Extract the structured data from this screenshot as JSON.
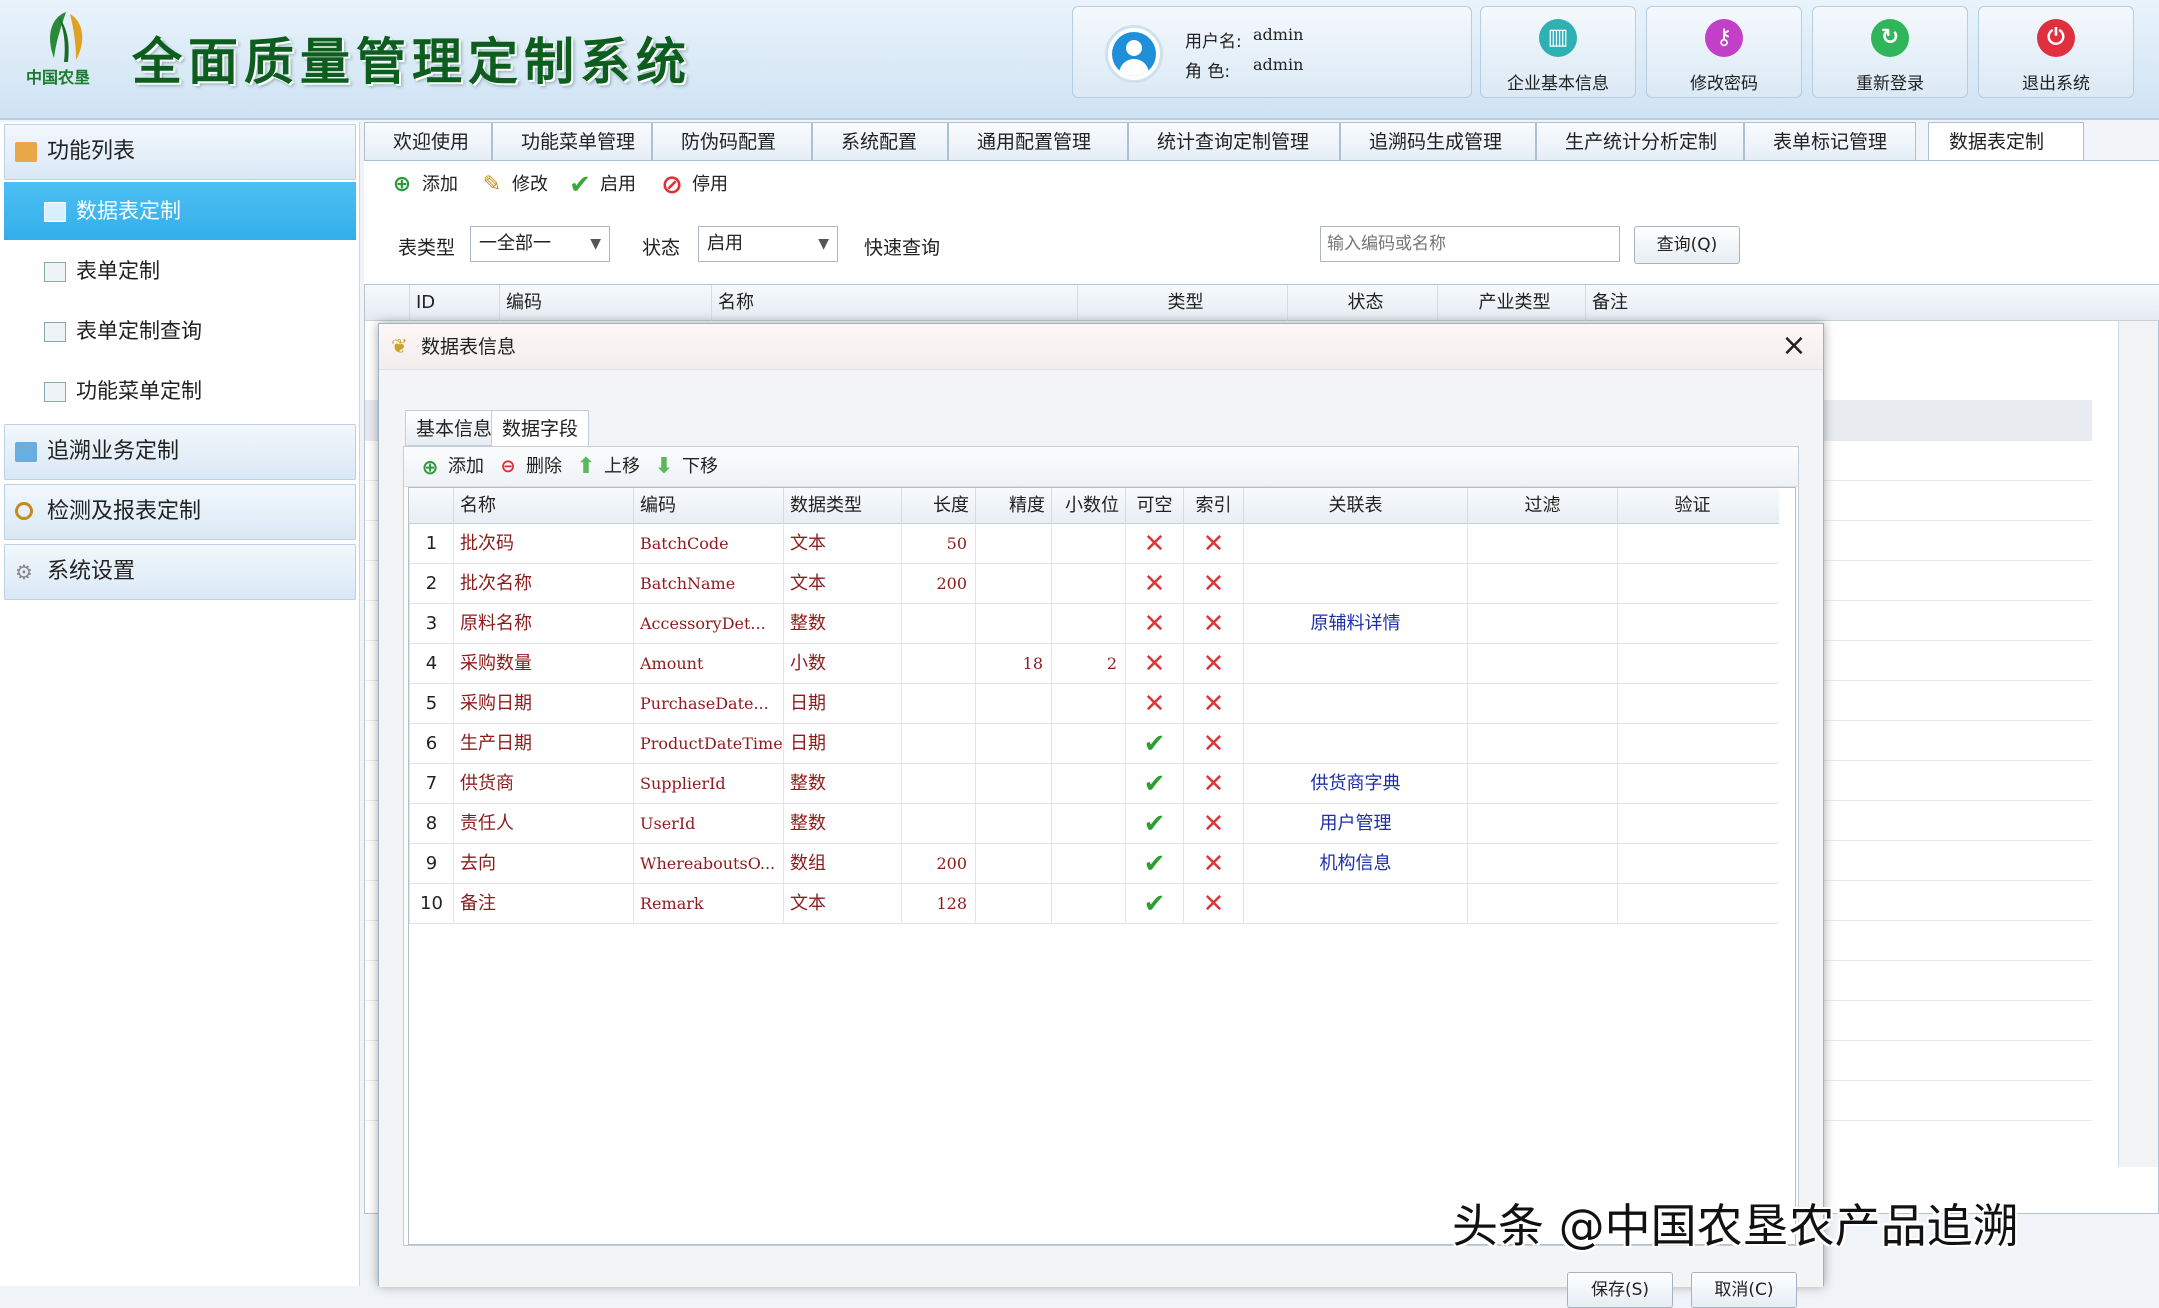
{
  "header": {
    "logo_text": "中国农垦",
    "title": "全面质量管理定制系统",
    "user_label": "用户名:",
    "user_value": "admin",
    "role_label": "角 色:",
    "role_value": "admin",
    "buttons": [
      {
        "label": "企业基本信息",
        "icon": "book-icon",
        "color": "#2fb0b5"
      },
      {
        "label": "修改密码",
        "icon": "key-icon",
        "color": "#c23fc8"
      },
      {
        "label": "重新登录",
        "icon": "refresh-icon",
        "color": "#2fb65a"
      },
      {
        "label": "退出系统",
        "icon": "power-icon",
        "color": "#e03040"
      }
    ]
  },
  "sidebar": {
    "groups": [
      {
        "label": "功能列表"
      },
      {
        "label": "追溯业务定制"
      },
      {
        "label": "检测及报表定制"
      },
      {
        "label": "系统设置"
      }
    ],
    "items": [
      {
        "label": "数据表定制"
      },
      {
        "label": "表单定制"
      },
      {
        "label": "表单定制查询"
      },
      {
        "label": "功能菜单定制"
      }
    ]
  },
  "tabs": [
    "欢迎使用",
    "功能菜单管理",
    "防伪码配置",
    "系统配置",
    "通用配置管理",
    "统计查询定制管理",
    "追溯码生成管理",
    "生产统计分析定制",
    "表单标记管理",
    "数据表定制"
  ],
  "toolbar": {
    "add": "添加",
    "edit": "修改",
    "enable": "启用",
    "disable": "停用"
  },
  "filter": {
    "type_label": "表类型",
    "type_value": "一全部一",
    "status_label": "状态",
    "status_value": "启用",
    "quick_label": "快速查询",
    "search_placeholder": "输入编码或名称",
    "query_button": "查询(Q)"
  },
  "grid": {
    "columns": [
      "ID",
      "编码",
      "名称",
      "类型",
      "状态",
      "产业类型",
      "备注"
    ]
  },
  "dialog": {
    "title": "数据表信息",
    "tabs": [
      "基本信息",
      "数据字段"
    ],
    "toolbar": {
      "add": "添加",
      "delete": "删除",
      "up": "上移",
      "down": "下移"
    },
    "columns": [
      "名称",
      "编码",
      "数据类型",
      "长度",
      "精度",
      "小数位",
      "可空",
      "索引",
      "关联表",
      "过滤",
      "验证"
    ],
    "rows": [
      {
        "num": "1",
        "name": "批次码",
        "code": "BatchCode",
        "type": "文本",
        "length": "50",
        "precision": "",
        "scale": "",
        "nullable": false,
        "index": false,
        "relation": ""
      },
      {
        "num": "2",
        "name": "批次名称",
        "code": "BatchName",
        "type": "文本",
        "length": "200",
        "precision": "",
        "scale": "",
        "nullable": false,
        "index": false,
        "relation": ""
      },
      {
        "num": "3",
        "name": "原料名称",
        "code": "AccessoryDet...",
        "type": "整数",
        "length": "",
        "precision": "",
        "scale": "",
        "nullable": false,
        "index": false,
        "relation": "原辅料详情"
      },
      {
        "num": "4",
        "name": "采购数量",
        "code": "Amount",
        "type": "小数",
        "length": "",
        "precision": "18",
        "scale": "2",
        "nullable": false,
        "index": false,
        "relation": ""
      },
      {
        "num": "5",
        "name": "采购日期",
        "code": "PurchaseDate...",
        "type": "日期",
        "length": "",
        "precision": "",
        "scale": "",
        "nullable": false,
        "index": false,
        "relation": ""
      },
      {
        "num": "6",
        "name": "生产日期",
        "code": "ProductDateTime",
        "type": "日期",
        "length": "",
        "precision": "",
        "scale": "",
        "nullable": true,
        "index": false,
        "relation": ""
      },
      {
        "num": "7",
        "name": "供货商",
        "code": "SupplierId",
        "type": "整数",
        "length": "",
        "precision": "",
        "scale": "",
        "nullable": true,
        "index": false,
        "relation": "供货商字典"
      },
      {
        "num": "8",
        "name": "责任人",
        "code": "UserId",
        "type": "整数",
        "length": "",
        "precision": "",
        "scale": "",
        "nullable": true,
        "index": false,
        "relation": "用户管理"
      },
      {
        "num": "9",
        "name": "去向",
        "code": "WhereaboutsO...",
        "type": "数组",
        "length": "200",
        "precision": "",
        "scale": "",
        "nullable": true,
        "index": false,
        "relation": "机构信息"
      },
      {
        "num": "10",
        "name": "备注",
        "code": "Remark",
        "type": "文本",
        "length": "128",
        "precision": "",
        "scale": "",
        "nullable": true,
        "index": false,
        "relation": ""
      }
    ],
    "save_button": "保存(S)",
    "cancel_button": "取消(C)"
  },
  "watermark": "头条 @中国农垦农产品追溯"
}
